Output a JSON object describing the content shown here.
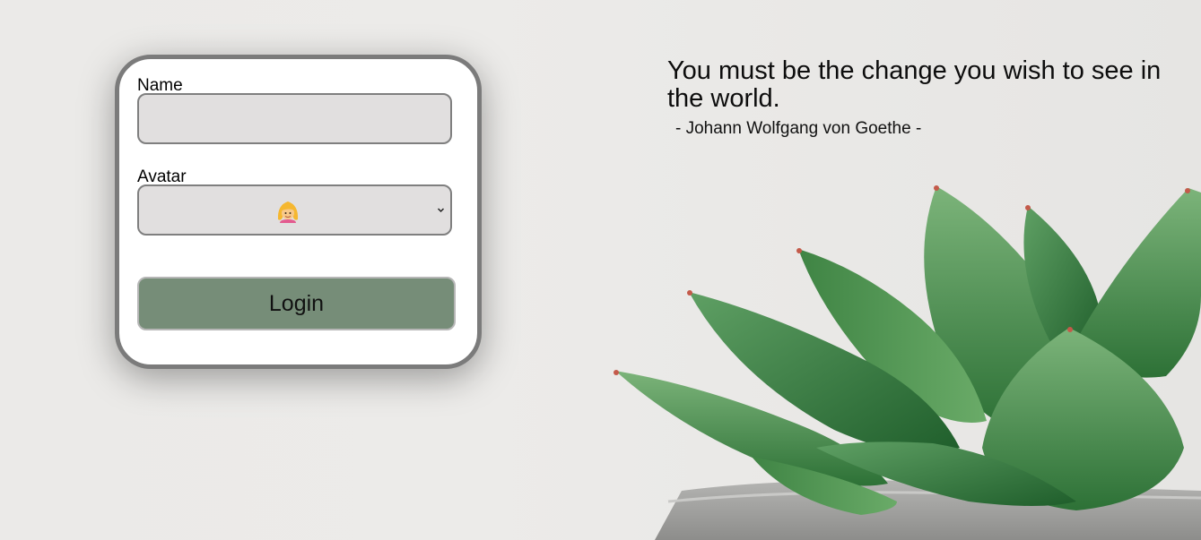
{
  "form": {
    "name_label": "Name",
    "name_value": "",
    "avatar_label": "Avatar",
    "avatar_selected": "person-with-yellow-hair-emoji",
    "login_label": "Login"
  },
  "quote": {
    "text": "You must be the change you wish to see in the world.",
    "author": "- Johann Wolfgang von Goethe -"
  },
  "colors": {
    "input_bg": "#e1dfdf",
    "button_bg": "#768d78",
    "card_border": "#7b7b7b",
    "background": "#ebeae8"
  },
  "background_image": "succulent-plant-in-pot"
}
